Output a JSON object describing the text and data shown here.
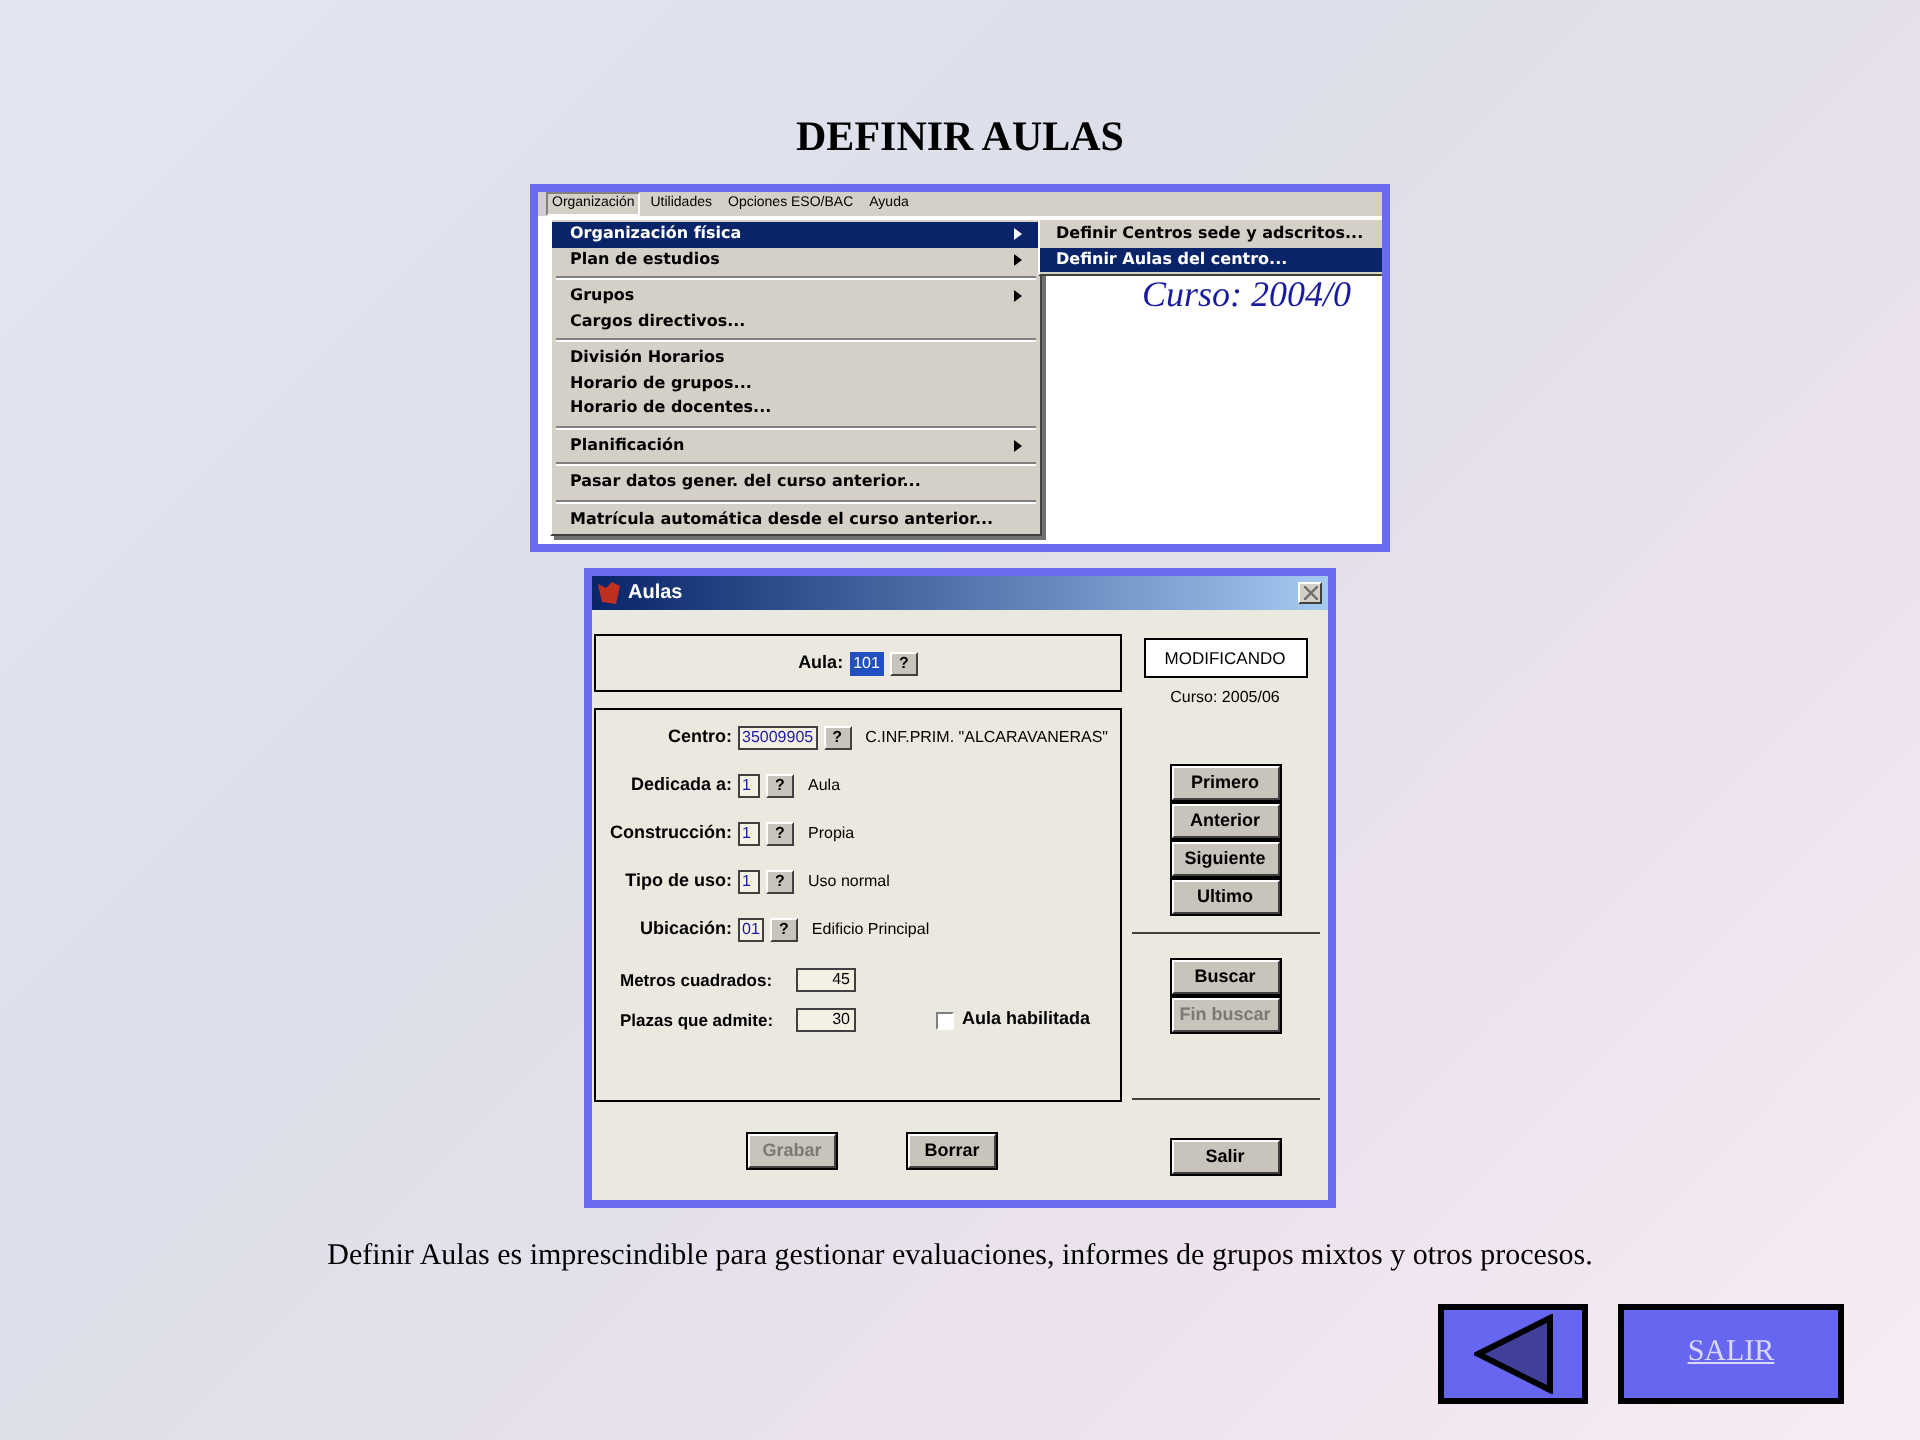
{
  "title": "DEFINIR AULAS",
  "menu_screenshot": {
    "menubar": [
      {
        "label": "Organización",
        "selected": true
      },
      {
        "label": "Utilidades",
        "selected": false
      },
      {
        "label": "Opciones ESO/BAC",
        "selected": false
      },
      {
        "label": "Ayuda",
        "selected": false
      }
    ],
    "menu": [
      {
        "kind": "item",
        "label": "Organización física",
        "submenu": true,
        "selected": true
      },
      {
        "kind": "item",
        "label": "Plan de estudios",
        "submenu": true,
        "selected": false
      },
      {
        "kind": "separator"
      },
      {
        "kind": "item",
        "label": "Grupos",
        "submenu": true,
        "selected": false
      },
      {
        "kind": "item",
        "label": "Cargos directivos...",
        "submenu": false,
        "selected": false
      },
      {
        "kind": "separator"
      },
      {
        "kind": "item",
        "label": "División Horarios",
        "submenu": false,
        "selected": false
      },
      {
        "kind": "item",
        "label": "Horario de grupos...",
        "submenu": false,
        "selected": false
      },
      {
        "kind": "item",
        "label": "Horario de docentes...",
        "submenu": false,
        "selected": false
      },
      {
        "kind": "separator"
      },
      {
        "kind": "item",
        "label": "Planificación",
        "submenu": true,
        "selected": false
      },
      {
        "kind": "separator"
      },
      {
        "kind": "item",
        "label": "Pasar datos gener. del curso anterior...",
        "submenu": false,
        "selected": false
      },
      {
        "kind": "separator"
      },
      {
        "kind": "item",
        "label": "Matrícula automática desde el curso anterior...",
        "submenu": false,
        "selected": false
      }
    ],
    "submenu": [
      {
        "label": "Definir Centros sede y adscritos...",
        "selected": false
      },
      {
        "label": "Definir Aulas del centro...",
        "selected": true
      }
    ],
    "background_text": "Curso: 2004/0"
  },
  "dialog": {
    "title": "Aulas",
    "aula": {
      "label": "Aula:",
      "value": "101",
      "help": "?",
      "selected": true
    },
    "status": "MODIFICANDO",
    "course": "Curso: 2005/06",
    "rows": [
      {
        "label": "Centro:",
        "code": "35009905",
        "help": "?",
        "description": "C.INF.PRIM. \"ALCARAVANERAS\""
      },
      {
        "label": "Dedicada a:",
        "code": "1",
        "help": "?",
        "description": "Aula"
      },
      {
        "label": "Construcción:",
        "code": "1",
        "help": "?",
        "description": "Propia"
      },
      {
        "label": "Tipo de uso:",
        "code": "1",
        "help": "?",
        "description": "Uso normal"
      },
      {
        "label": "Ubicación:",
        "code": "01",
        "help": "?",
        "description": "Edificio Principal"
      }
    ],
    "numbers": [
      {
        "label": "Metros cuadrados:",
        "value": "45"
      },
      {
        "label": "Plazas que admite:",
        "value": "30"
      }
    ],
    "checkbox": {
      "label": "Aula habilitada",
      "checked": false
    },
    "nav_buttons": [
      {
        "label": "Primero",
        "disabled": false
      },
      {
        "label": "Anterior",
        "disabled": false
      },
      {
        "label": "Siguiente",
        "disabled": false
      },
      {
        "label": "Ultimo",
        "disabled": false
      }
    ],
    "search_buttons": [
      {
        "label": "Buscar",
        "disabled": false
      },
      {
        "label": "Fin buscar",
        "disabled": true
      }
    ],
    "bottom_buttons": [
      {
        "label": "Grabar",
        "disabled": true
      },
      {
        "label": "Borrar",
        "disabled": false
      }
    ],
    "exit_button": {
      "label": "Salir",
      "disabled": false
    }
  },
  "caption": "Definir Aulas es imprescindible para gestionar evaluaciones, informes de grupos mixtos y otros procesos.",
  "exit_link": "SALIR"
}
